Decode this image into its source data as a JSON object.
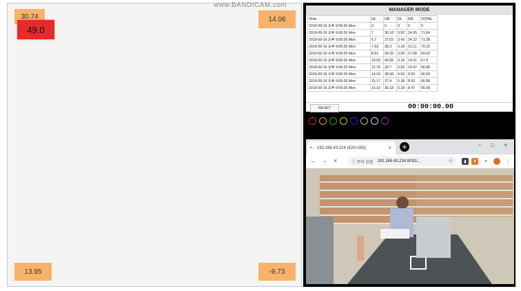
{
  "values": {
    "top_left": "30.74",
    "top_left_badge": "49.0",
    "top_right": "14.06",
    "bottom_left": "13.95",
    "bottom_right": "-9.73"
  },
  "watermark": "www.BANDICAM.com",
  "manager": {
    "title": "MANAGER MODE",
    "columns": [
      "Time",
      "UL",
      "UR",
      "DL",
      "DR",
      "TOTAL"
    ],
    "rows": [
      [
        "2019-09-16 오후 9:09:26 Mon",
        "0",
        "0",
        "0",
        "0",
        "0"
      ],
      [
        "2019-09-16 오후 9:09:26 Mon",
        "7",
        "36.18",
        "3.92",
        "24.55",
        "71.64"
      ],
      [
        "2019-09-16 오후 9:09:26 Mon",
        "6.7",
        "37.02",
        "3.43",
        "24.22",
        "71.38"
      ],
      [
        "2019-09-16 오후 9:09:26 Mon",
        "7.63",
        "38.3",
        "3.18",
        "21.11",
        "70.22"
      ],
      [
        "2019-09-16 오후 9:09:26 Mon",
        "8.91",
        "39.33",
        "3.09",
        "17.68",
        "69.02"
      ],
      [
        "2019-09-16 오후 9:09:26 Mon",
        "10.53",
        "40.09",
        "3.18",
        "14.01",
        "67.8"
      ],
      [
        "2019-09-16 오후 9:09:26 Mon",
        "12.76",
        "39.7",
        "3.92",
        "10.47",
        "66.86"
      ],
      [
        "2019-09-16 오후 9:09:26 Mon",
        "14.03",
        "38.58",
        "4.63",
        "9.59",
        "66.83"
      ],
      [
        "2019-09-16 오후 9:09:26 Mon",
        "15.17",
        "37.4",
        "5.38",
        "8.93",
        "66.88"
      ],
      [
        "2019-09-16 오후 9:09:26 Mon",
        "16.16",
        "36.18",
        "6.18",
        "8.47",
        "66.99"
      ]
    ],
    "reset_label": "RESET",
    "timer": "00:00:00.00"
  },
  "circle_colors": [
    "#d22",
    "#e8a020",
    "#2a2",
    "#cc2",
    "#22c",
    "#bbb",
    "#ddd",
    "#a2c"
  ],
  "browser": {
    "tab_title": "192.168.43.224 (620×250)",
    "tab_close": "×",
    "new_tab": "+",
    "back_icon": "←",
    "forward_icon": "→",
    "stop_icon": "×",
    "security_label": "ⓘ 주의 요함",
    "address": "192.168.43.224:8091/...",
    "star_icon": "☆",
    "window_controls": "− □ ×"
  }
}
